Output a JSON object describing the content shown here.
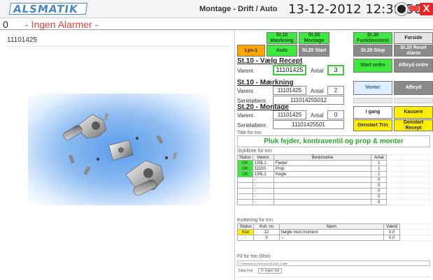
{
  "app": {
    "logo": "ALSMATIK",
    "title": "Montage - Drift / Auto",
    "clock": "13-12-2012 12:39:50",
    "close_label": "X"
  },
  "alarms": {
    "count": "0",
    "text": "- Ingen Alarmer -"
  },
  "left": {
    "part_number": "11101425"
  },
  "buttons": {
    "st10_mark": "St.10 Mærkning",
    "st20_mont": "St.20 Montage",
    "st30_func": "St.30 Funktionstest",
    "forside": "Forside",
    "lys": "Lys-1",
    "auto": "Auto",
    "st20_start": "St.20 Start",
    "st20_stop": "St.20 Stop",
    "st20_reset": "St.20 Reset Alarm",
    "start_ordre": "Start ordre",
    "afbryd_ordre": "Afbryd ordre",
    "venter": "Venter",
    "afbryd": "Afbryd",
    "i_gang": "I gang",
    "kassere": "Kassere",
    "genstart_trin": "Genstart Trin",
    "genstart_recept": "Genstart Recept"
  },
  "st10_recept": {
    "title": "St.10 - Vælg Recept",
    "varenr_label": "Varenr.",
    "varenr": "11101425",
    "antal_label": "Antal",
    "antal": "3"
  },
  "st10_mark": {
    "title": "St.10 - Mærkning",
    "varenr_label": "Varenr.",
    "varenr": "11101425",
    "antal_label": "Antal",
    "antal": "2",
    "serie_label": "Serieløbenr.",
    "serie": "111014255012"
  },
  "st20_mont": {
    "title": "St.20 - Montage",
    "varenr_label": "Varenr.",
    "varenr": "11101425",
    "antal_label": "Antal",
    "antal": "0",
    "serie_label": "Serieløbenr.",
    "serie": "11101425501"
  },
  "trin": {
    "title_label": "Title for trin",
    "title": "Pluk fejder, kontraventil og prop & monter"
  },
  "styk": {
    "label": "Styklliste for trin",
    "headers": [
      "Status",
      "Varenr.",
      "Beskrivelse",
      "Antal"
    ],
    "rows": [
      {
        "status": "OK",
        "varenr": "155L1",
        "besk": "Fjeder",
        "antal": "1"
      },
      {
        "status": "OK",
        "varenr": "11100",
        "besk": "Prop",
        "antal": "1"
      },
      {
        "status": "OK",
        "varenr": "155L1",
        "besk": "Kegle",
        "antal": "1"
      },
      {
        "status": "",
        "varenr": "-",
        "besk": "",
        "antal": "0"
      },
      {
        "status": "",
        "varenr": "-",
        "besk": "",
        "antal": "0"
      },
      {
        "status": "",
        "varenr": "-",
        "besk": "",
        "antal": "0"
      },
      {
        "status": "",
        "varenr": "-",
        "besk": "",
        "antal": "0"
      },
      {
        "status": "",
        "varenr": "-",
        "besk": "",
        "antal": "0"
      }
    ]
  },
  "kvit": {
    "label": "Kvittering for trin",
    "headers": [
      "Status",
      "Kvit. no",
      "Navn",
      "Værdi"
    ],
    "rows": [
      {
        "status": "Klar",
        "no": "12",
        "navn": "Nøgle med moment",
        "vaerdi": "0,0"
      },
      {
        "status": "-",
        "no": "0",
        "navn": "--",
        "vaerdi": "0,0"
      }
    ]
  },
  "fil": {
    "label": "Fil for trin (filsti)",
    "path": "C:\\element\\1122\\html\\11101425_3.html"
  },
  "data": {
    "label": "Data Fejl",
    "value": "0: Ingen fejl"
  }
}
